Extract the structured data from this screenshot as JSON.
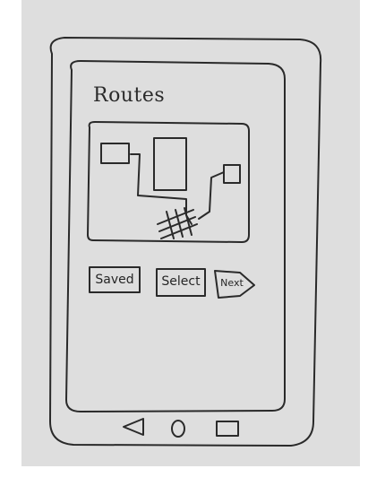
{
  "screen": {
    "title": "Routes"
  },
  "actions": {
    "saved_label": "Saved",
    "select_label": "Select",
    "next_label": "Next"
  },
  "nav": {
    "back_icon": "triangle-back-icon",
    "home_icon": "circle-home-icon",
    "recents_icon": "square-recents-icon"
  }
}
